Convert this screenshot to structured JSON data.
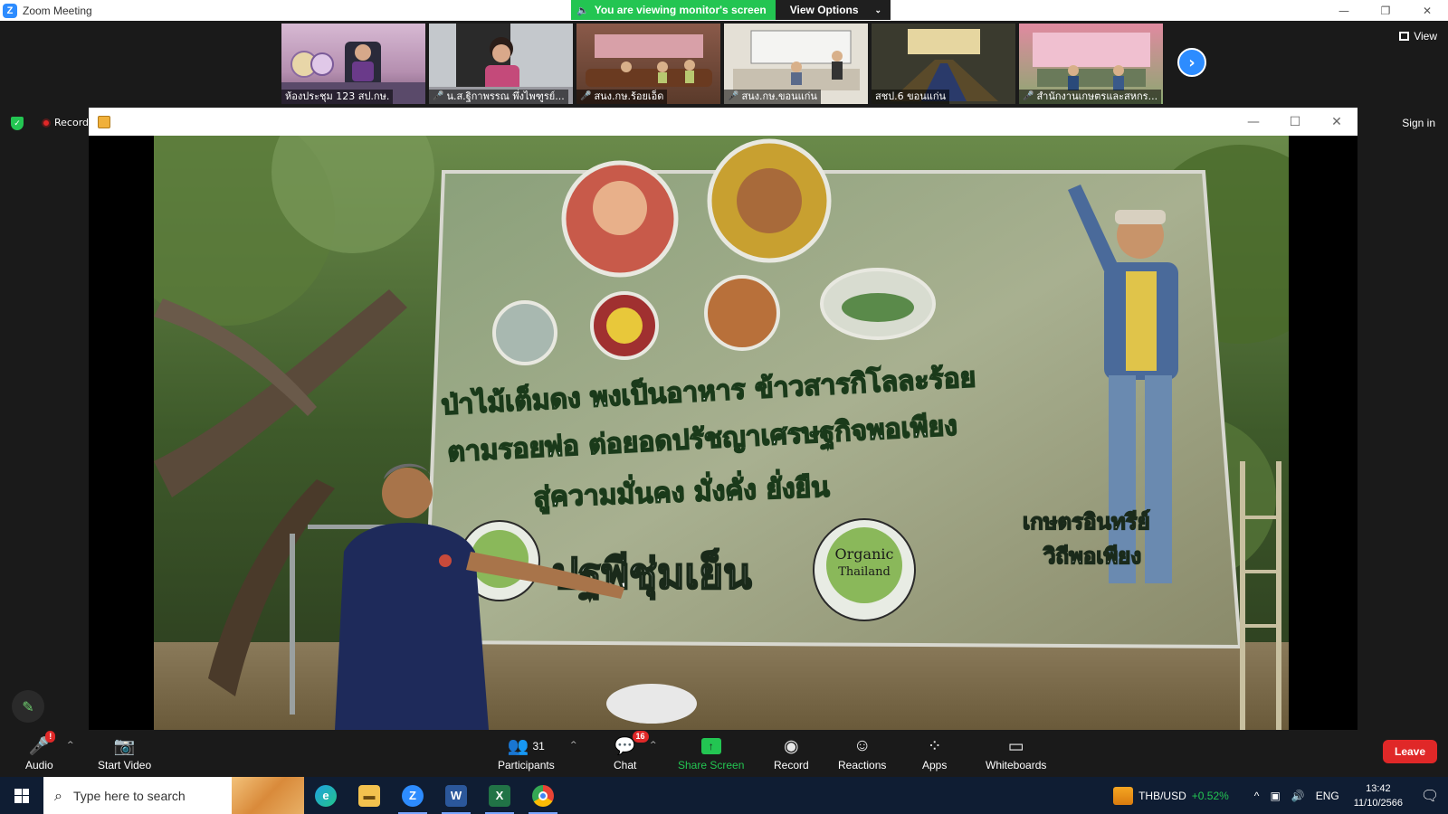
{
  "window": {
    "title": "Zoom Meeting",
    "logo_letter": "Z",
    "minimize": "—",
    "restore": "❐",
    "close": "✕"
  },
  "share_banner": {
    "message": "You are viewing monitor's screen",
    "options_label": "View Options"
  },
  "thumbnails": [
    {
      "label": "ห้องประชุม 123 สป.กษ.",
      "muted": false,
      "bg": "#c8a6c4"
    },
    {
      "label": "น.ส.ฐิกาพรรณ พึ่งไพฑูรย์...",
      "muted": true,
      "bg": "#b9c0c8"
    },
    {
      "label": "สนง.กษ.ร้อยเอ็ด",
      "muted": true,
      "bg": "#8a6a5a"
    },
    {
      "label": "สนง.กษ.ขอนแก่น",
      "muted": true,
      "bg": "#d8d4cc"
    },
    {
      "label": "สชป.6 ขอนแก่น",
      "muted": false,
      "bg": "#4a4a3a"
    },
    {
      "label": "สำนักงานเกษตรและสหกร...",
      "muted": true,
      "bg": "#c66a88"
    }
  ],
  "top_right": {
    "view_label": "View",
    "sign_in": "Sign in"
  },
  "recording_label": "Record",
  "toolbar": {
    "audio": {
      "label": "Audio",
      "badge": "!"
    },
    "video": {
      "label": "Start Video"
    },
    "participants": {
      "label": "Participants",
      "count": "31"
    },
    "chat": {
      "label": "Chat",
      "badge": "16"
    },
    "share": {
      "label": "Share Screen"
    },
    "record": {
      "label": "Record"
    },
    "reactions": {
      "label": "Reactions"
    },
    "apps": {
      "label": "Apps"
    },
    "whiteboards": {
      "label": "Whiteboards"
    },
    "leave": {
      "label": "Leave"
    }
  },
  "banner_text": {
    "line1": "ป่าไม้เต็มดง พงเป็นอาหาร ข้าวสารกิโลละร้อย",
    "line2": "ตามรอยพ่อ ต่อยอดปรัชญาเศรษฐกิจพอเพียง",
    "line3": "สู่ความมั่นคง มั่งคั่ง ยั่งยืน",
    "title": "ปฐพีชุ่มเย็น",
    "side1": "เกษตรอินทรีย์",
    "side2": "วิถีพอเพียง",
    "organic1": "Organic",
    "organic2": "Thailand"
  },
  "taskbar": {
    "search_placeholder": "Type here to search",
    "stock_pair": "THB/USD",
    "stock_change": "+0.52%",
    "lang": "ENG",
    "time": "13:42",
    "date": "11/10/2566"
  }
}
